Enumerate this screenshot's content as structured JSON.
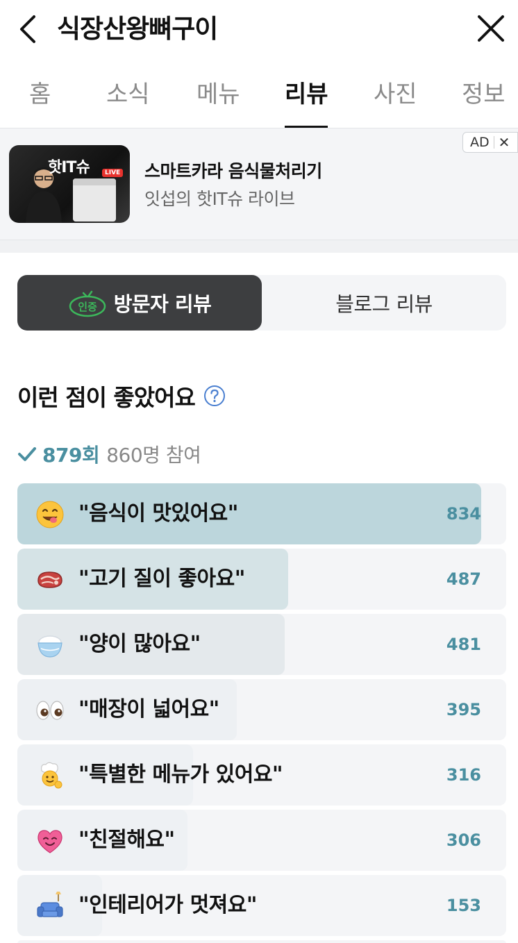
{
  "header": {
    "title": "식장산왕뼈구이"
  },
  "tabs": [
    "홈",
    "소식",
    "메뉴",
    "리뷰",
    "사진",
    "정보"
  ],
  "active_tab": "리뷰",
  "ad": {
    "title": "스마트카라 음식물처리기",
    "subtitle": "잇섭의 핫IT슈 라이브",
    "badge": "AD",
    "close": "✕",
    "thumb_logo": "핫IT슈",
    "thumb_live": "LIVE"
  },
  "review_toggle": {
    "visitor": "방문자 리뷰",
    "cert_badge": "인증",
    "blog": "블로그 리뷰"
  },
  "section": {
    "title": "이런 점이 좋았어요"
  },
  "stats": {
    "count": "879회",
    "people": "860명 참여"
  },
  "keywords": [
    {
      "label": "\"음식이 맛있어요\"",
      "count": "834",
      "fraction": 0.949,
      "icon": "yum-face-icon",
      "color": "#bcd6dc"
    },
    {
      "label": "\"고기 질이 좋아요\"",
      "count": "487",
      "fraction": 0.554,
      "icon": "meat-icon",
      "color": "#d5e3e6"
    },
    {
      "label": "\"양이 많아요\"",
      "count": "481",
      "fraction": 0.547,
      "icon": "rice-bowl-icon",
      "color": "#e4e9ec"
    },
    {
      "label": "\"매장이 넓어요\"",
      "count": "395",
      "fraction": 0.449,
      "icon": "eyes-icon",
      "color": "#edf0f3"
    },
    {
      "label": "\"특별한 메뉴가 있어요\"",
      "count": "316",
      "fraction": 0.36,
      "icon": "chef-icon",
      "color": "#eef1f4"
    },
    {
      "label": "\"친절해요\"",
      "count": "306",
      "fraction": 0.348,
      "icon": "heart-face-icon",
      "color": "#eef1f4"
    },
    {
      "label": "\"인테리어가 멋져요\"",
      "count": "153",
      "fraction": 0.174,
      "icon": "sofa-icon",
      "color": "#eef1f4"
    }
  ]
}
